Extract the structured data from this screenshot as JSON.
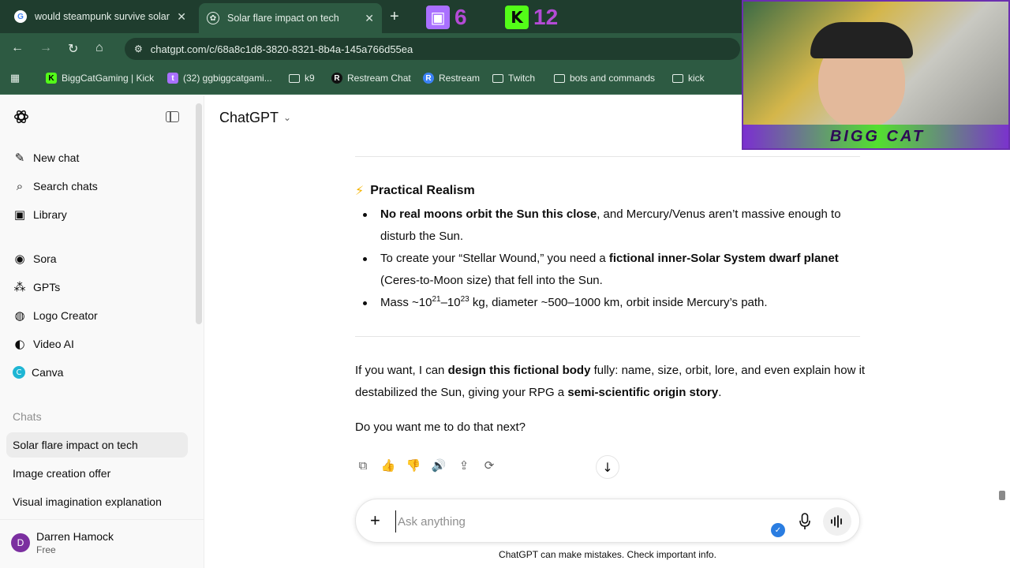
{
  "browser": {
    "tabs": [
      {
        "title": "would steampunk survive solar",
        "active": false
      },
      {
        "title": "Solar flare impact on tech",
        "active": true
      }
    ],
    "address": "chatgpt.com/c/68a8c1d8-3820-8321-8b4a-145a766d55ea",
    "bookmarks": [
      {
        "label": "BiggCatGaming | Kick",
        "icon": "kick-icon"
      },
      {
        "label": "(32) ggbiggcatgami...",
        "icon": "twitch-icon"
      },
      {
        "label": "k9",
        "icon": "folder-icon"
      },
      {
        "label": "Restream Chat",
        "icon": "restream-icon"
      },
      {
        "label": "Restream",
        "icon": "restream-icon"
      },
      {
        "label": "Twitch",
        "icon": "folder-icon"
      },
      {
        "label": "bots and commands",
        "icon": "folder-icon"
      },
      {
        "label": "kick",
        "icon": "folder-icon"
      }
    ]
  },
  "overlay": {
    "twitch_count": "6",
    "kick_count": "12",
    "webcam_banner": "BIGG CAT"
  },
  "sidebar": {
    "items": [
      {
        "label": "New chat",
        "icon": "compose-icon"
      },
      {
        "label": "Search chats",
        "icon": "search-icon"
      },
      {
        "label": "Library",
        "icon": "library-icon"
      },
      {
        "label": "Sora",
        "icon": "sora-icon"
      },
      {
        "label": "GPTs",
        "icon": "gpts-icon"
      },
      {
        "label": "Logo Creator",
        "icon": "logo-creator-icon"
      },
      {
        "label": "Video AI",
        "icon": "video-ai-icon"
      },
      {
        "label": "Canva",
        "icon": "canva-icon"
      }
    ],
    "chats_heading": "Chats",
    "chats": [
      {
        "label": "Solar flare impact on tech",
        "selected": true
      },
      {
        "label": "Image creation offer",
        "selected": false
      },
      {
        "label": "Visual imagination explanation",
        "selected": false
      }
    ],
    "user": {
      "initial": "D",
      "name": "Darren Hamock",
      "plan": "Free"
    }
  },
  "header": {
    "model": "ChatGPT"
  },
  "message": {
    "section_title": "Practical Realism",
    "bullets": [
      {
        "bold": "No real moons orbit the Sun this close",
        "rest": ", and Mercury/Venus aren’t massive enough to disturb the Sun."
      },
      {
        "pre": "To create your “Stellar Wound,” you need a ",
        "bold": "fictional inner-Solar System dwarf planet",
        "rest": " (Ceres-to-Moon size) that fell into the Sun."
      },
      {
        "mass_pre": "Mass ~10",
        "exp1": "21",
        "mid": "–10",
        "exp2": "23",
        "rest": " kg, diameter ~500–1000 km, orbit inside Mercury’s path."
      }
    ],
    "para1": {
      "a": "If you want, I can ",
      "b1": "design this fictional body",
      "c": " fully: name, size, orbit, lore, and even explain how it destabilized the Sun, giving your RPG a ",
      "b2": "semi-scientific origin story",
      "d": "."
    },
    "para2": "Do you want me to do that next?"
  },
  "composer": {
    "placeholder": "Ask anything"
  },
  "disclaimer": "ChatGPT can make mistakes. Check important info."
}
